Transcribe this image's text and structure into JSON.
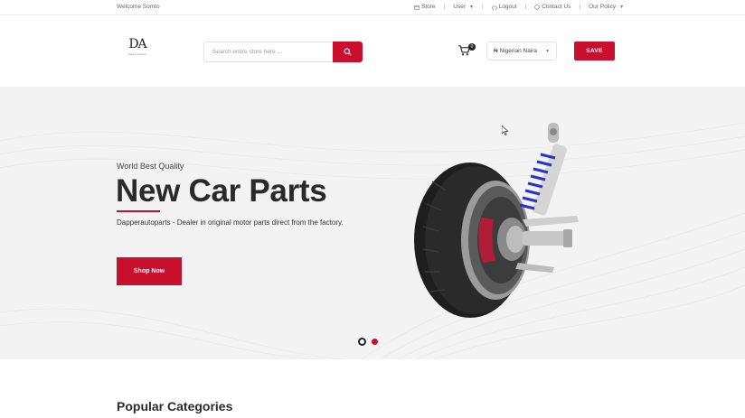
{
  "topbar": {
    "welcome": "Welcome Somto",
    "nav": [
      {
        "label": "Store",
        "icon": "store-icon"
      },
      {
        "label": "User",
        "icon": "",
        "dropdown": true
      },
      {
        "label": "Logout",
        "icon": "power-icon"
      },
      {
        "label": "Contact Us",
        "icon": "contact-icon"
      },
      {
        "label": "Our Policy",
        "icon": "",
        "dropdown": true
      }
    ]
  },
  "header": {
    "logo_mark": "DA",
    "logo_tagline": "Dapper Autoparts",
    "search_placeholder": "Search entire store here ...",
    "cart_count": "0",
    "currency": "₦ Nigerian Naira",
    "save_label": "SAVE"
  },
  "hero": {
    "eyebrow": "World Best Quality",
    "title": "New Car Parts",
    "description": "Dapperautoparts - Dealer in original motor parts direct from the factory.",
    "cta_label": "Shop Now",
    "slides": 2,
    "active_slide": 1
  },
  "sections": {
    "popular_categories": "Popular Categories"
  },
  "colors": {
    "accent": "#c8102e",
    "hero_bg": "#f3f3f3",
    "text_dark": "#2a2a2a"
  }
}
